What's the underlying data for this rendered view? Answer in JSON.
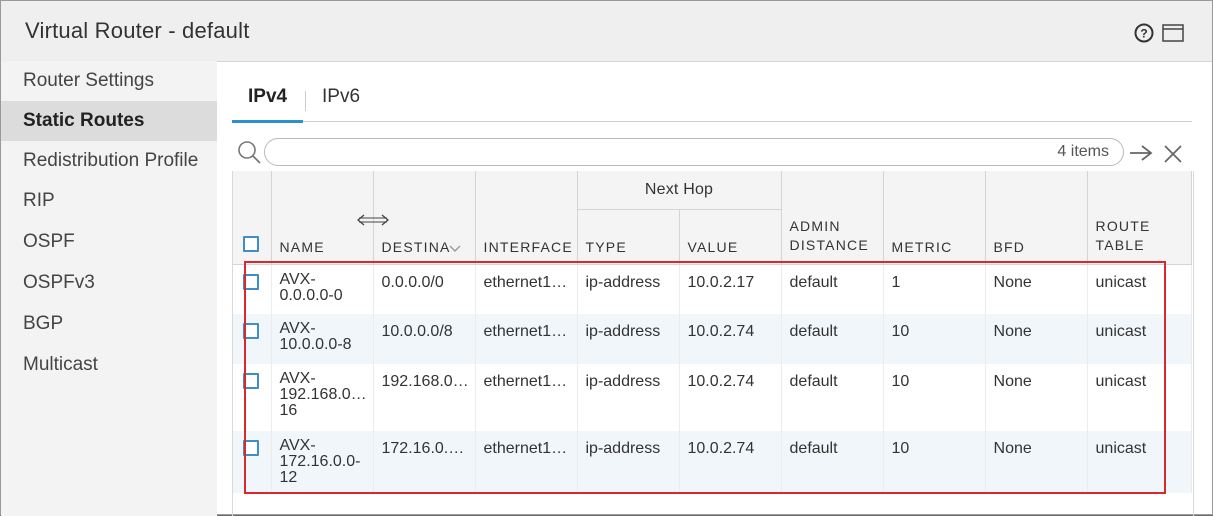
{
  "window": {
    "title": "Virtual Router - default"
  },
  "sidebar": {
    "items": [
      {
        "label": "Router Settings"
      },
      {
        "label": "Static Routes"
      },
      {
        "label": "Redistribution Profile"
      },
      {
        "label": "RIP"
      },
      {
        "label": "OSPF"
      },
      {
        "label": "OSPFv3"
      },
      {
        "label": "BGP"
      },
      {
        "label": "Multicast"
      }
    ],
    "active": "Static Routes"
  },
  "tabs": [
    {
      "label": "IPv4"
    },
    {
      "label": "IPv6"
    }
  ],
  "filter": {
    "placeholder": "",
    "count": "4 items"
  },
  "table": {
    "group_header": "Next Hop",
    "columns": {
      "name": "NAME",
      "destination": "DESTINA",
      "interface": "INTERFACE",
      "type": "TYPE",
      "value": "VALUE",
      "admin_distance": "ADMIN DISTANCE",
      "metric": "METRIC",
      "bfd": "BFD",
      "route_table": "ROUTE TABLE"
    },
    "rows": [
      {
        "name": "AVX-0.0.0.0-0",
        "destination": "0.0.0.0/0",
        "interface": "ethernet1…",
        "type": "ip-address",
        "value": "10.0.2.17",
        "admin_distance": "default",
        "metric": "1",
        "bfd": "None",
        "route_table": "unicast"
      },
      {
        "name": "AVX-10.0.0.0-8",
        "destination": "10.0.0.0/8",
        "interface": "ethernet1…",
        "type": "ip-address",
        "value": "10.0.2.74",
        "admin_distance": "default",
        "metric": "10",
        "bfd": "None",
        "route_table": "unicast"
      },
      {
        "name": "AVX-192.168.0…16",
        "destination": "192.168.0…",
        "interface": "ethernet1…",
        "type": "ip-address",
        "value": "10.0.2.74",
        "admin_distance": "default",
        "metric": "10",
        "bfd": "None",
        "route_table": "unicast"
      },
      {
        "name": "AVX-172.16.0.0-12",
        "destination": "172.16.0.…",
        "interface": "ethernet1…",
        "type": "ip-address",
        "value": "10.0.2.74",
        "admin_distance": "default",
        "metric": "10",
        "bfd": "None",
        "route_table": "unicast"
      }
    ],
    "name_lines": [
      [
        "AVX-",
        "0.0.0.0-0"
      ],
      [
        "AVX-",
        "10.0.0.0-8"
      ],
      [
        "AVX-",
        "192.168.0…",
        "16"
      ],
      [
        "AVX-",
        "172.16.0.0-",
        "12"
      ]
    ]
  },
  "colors": {
    "accent": "#2d8fcd",
    "highlight": "#d9282f",
    "row_alt": "#f1f6fa"
  },
  "icons": {
    "help": "help-circle-icon",
    "maximize": "maximize-icon",
    "search": "search-icon",
    "go": "arrow-right-icon",
    "clear": "close-icon",
    "resize": "column-resize-icon"
  }
}
